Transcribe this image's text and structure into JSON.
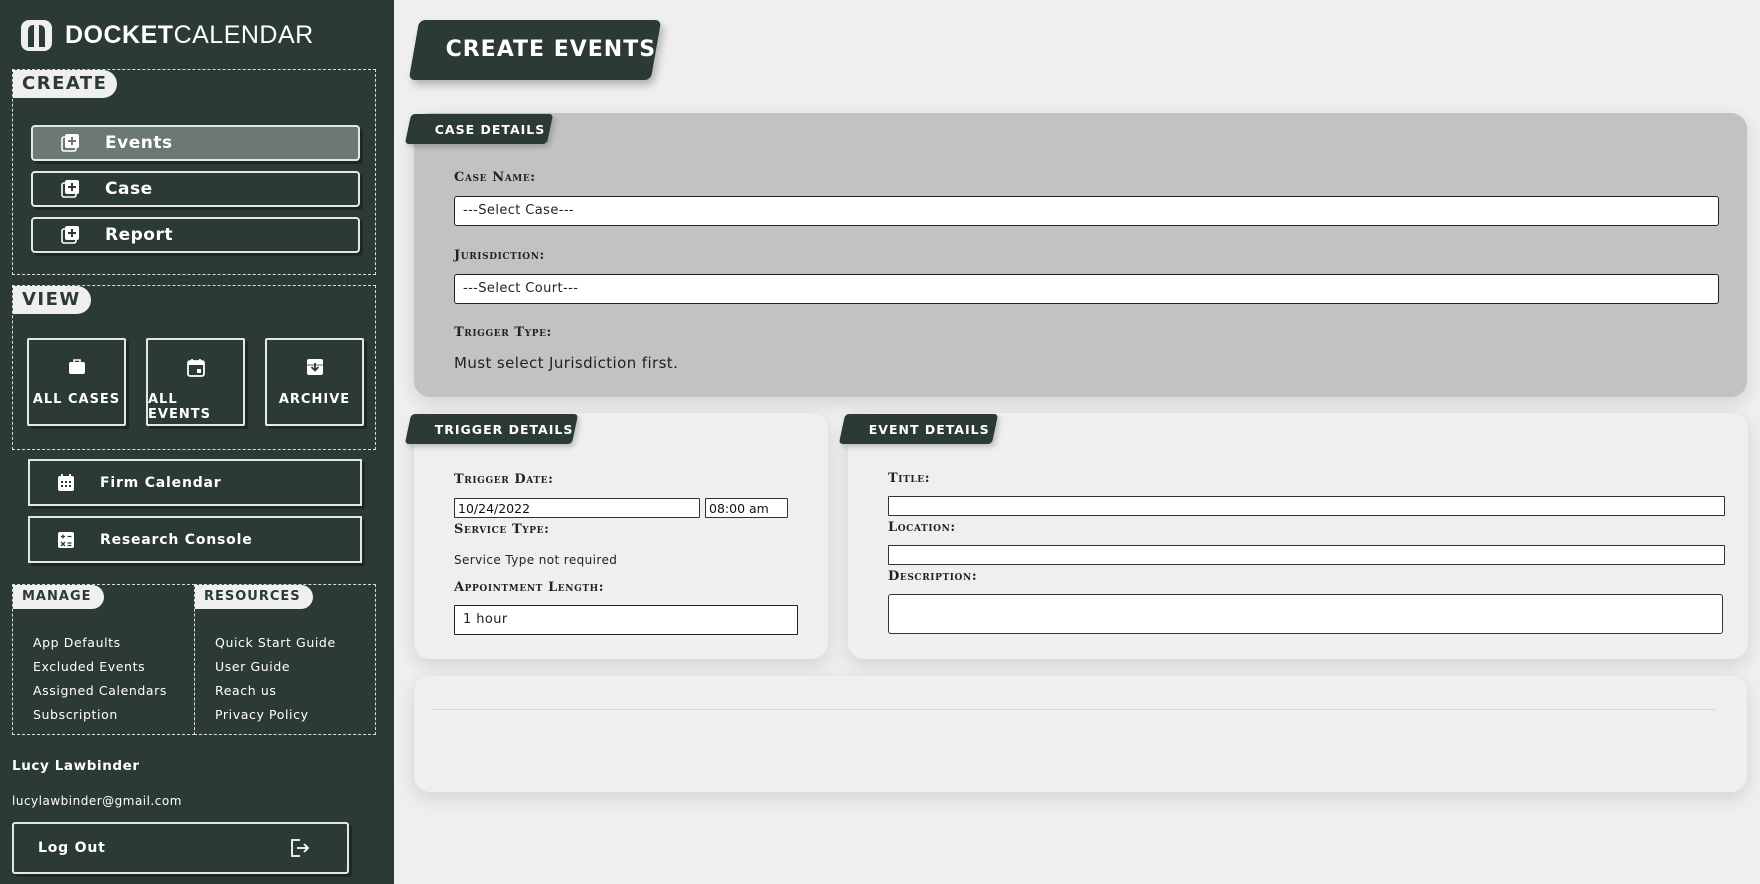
{
  "brand": {
    "bold": "DOCKET",
    "light": "CALENDAR"
  },
  "sidebar": {
    "create": {
      "title": "CREATE",
      "items": [
        {
          "label": "Events",
          "icon": "add-box-icon",
          "active": true
        },
        {
          "label": "Case",
          "icon": "add-box-icon",
          "active": false
        },
        {
          "label": "Report",
          "icon": "add-box-icon",
          "active": false
        }
      ]
    },
    "view": {
      "title": "VIEW",
      "cards": [
        {
          "label": "ALL CASES",
          "icon": "briefcase-icon"
        },
        {
          "label": "ALL EVENTS",
          "icon": "calendar-icon"
        },
        {
          "label": "ARCHIVE",
          "icon": "archive-icon"
        }
      ]
    },
    "firm_calendar": "Firm Calendar",
    "research_console": "Research Console",
    "manage": {
      "title": "MANAGE",
      "items": [
        "App Defaults",
        "Excluded Events",
        "Assigned Calendars",
        "Subscription"
      ]
    },
    "resources": {
      "title": "RESOURCES",
      "items": [
        "Quick Start Guide",
        "User Guide",
        "Reach us",
        "Privacy Policy"
      ]
    },
    "user": {
      "name": "Lucy Lawbinder",
      "email": "lucylawbinder@gmail.com"
    },
    "logout": "Log Out"
  },
  "main": {
    "title": "CREATE EVENTS",
    "case_details": {
      "tab": "CASE DETAILS",
      "case_name_label": "Case Name:",
      "case_select": "---Select Case---",
      "jurisdiction_label": "Jurisdiction:",
      "court_select": "---Select Court---",
      "trigger_type_label": "Trigger Type:",
      "trigger_type_text": "Must select Jurisdiction first."
    },
    "trigger_details": {
      "tab": "TRIGGER DETAILS",
      "trigger_date_label": "Trigger Date:",
      "trigger_date": "10/24/2022",
      "trigger_time": "08:00 am",
      "service_type_label": "Service Type:",
      "service_type_text": "Service Type not required",
      "appt_length_label": "Appointment Length:",
      "appt_length": "1 hour"
    },
    "event_details": {
      "tab": "EVENT DETAILS",
      "title_label": "Title:",
      "location_label": "Location:",
      "description_label": "Description:"
    }
  },
  "colors": {
    "sidebar_bg": "#2c3a37",
    "page_bg": "#eeefee",
    "case_panel_bg": "#c1c3c2",
    "active_item": "#6b7874"
  }
}
